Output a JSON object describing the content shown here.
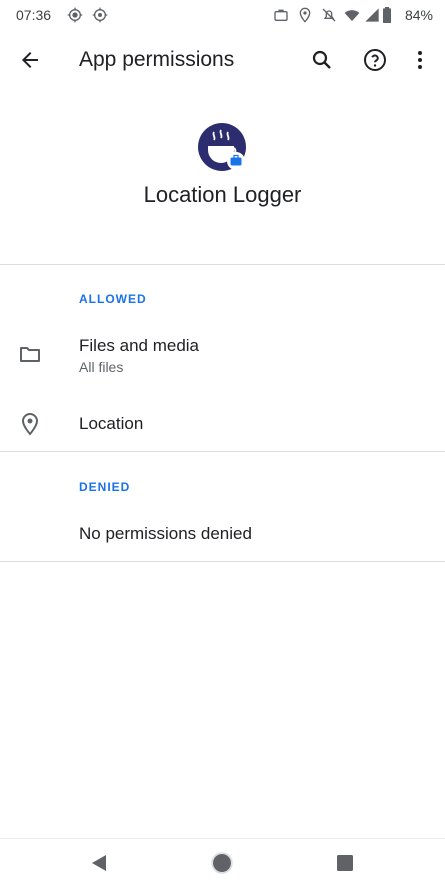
{
  "status_bar": {
    "time": "07:36",
    "battery": "84%",
    "left_icons": [
      "gps-icon",
      "location-target-icon"
    ],
    "right_icons": [
      "briefcase-icon",
      "location-pin-icon",
      "notifications-off-icon",
      "wifi-icon",
      "signal-icon",
      "battery-icon"
    ]
  },
  "toolbar": {
    "title": "App permissions",
    "back_icon": "arrow-back-icon",
    "search_icon": "search-icon",
    "help_icon": "help-icon",
    "more_icon": "more-vert-icon"
  },
  "app": {
    "name": "Location Logger",
    "icon": "coffee-cup-work-badge-icon"
  },
  "allowed": {
    "header": "ALLOWED",
    "items": [
      {
        "title": "Files and media",
        "subtitle": "All files",
        "icon": "folder-icon"
      },
      {
        "title": "Location",
        "subtitle": "",
        "icon": "location-pin-icon"
      }
    ]
  },
  "denied": {
    "header": "DENIED",
    "empty_text": "No permissions denied"
  },
  "nav": {
    "back_icon": "nav-back-icon",
    "home_icon": "nav-home-icon",
    "recents_icon": "nav-recents-icon"
  },
  "colors": {
    "accent": "#1a73e8",
    "app_icon_bg": "#2b2d6e",
    "text_primary": "#202124",
    "text_secondary": "#5f6368"
  }
}
